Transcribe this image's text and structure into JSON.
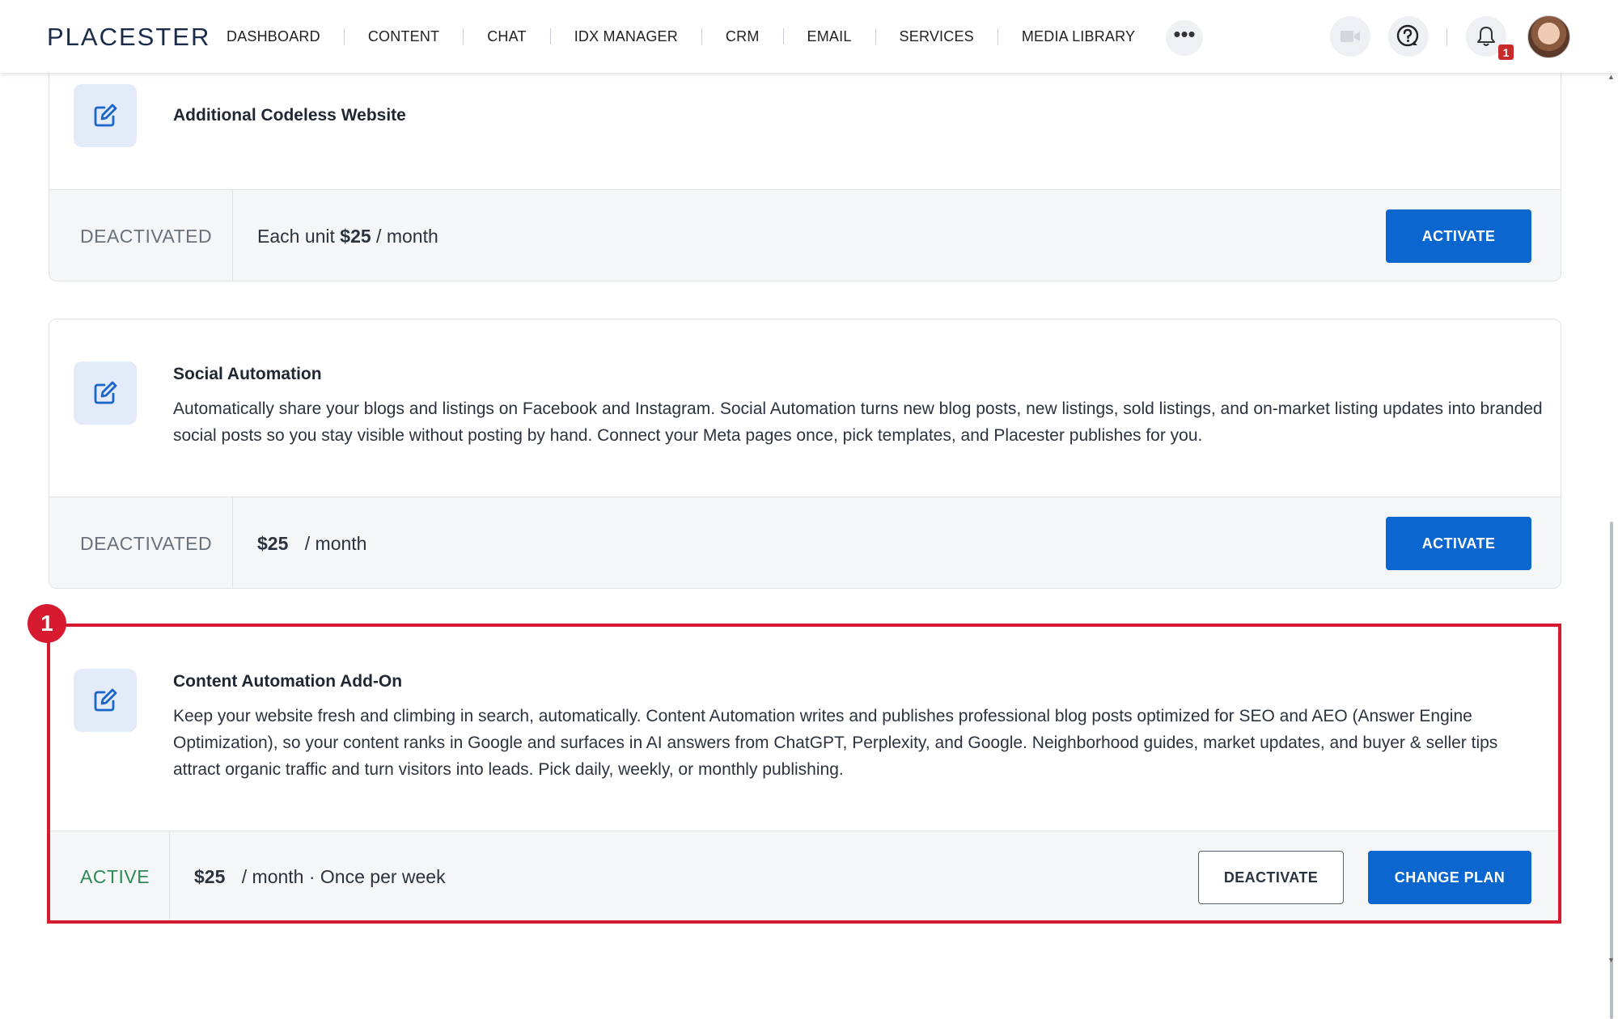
{
  "brand": {
    "logo": "PLACESTER",
    "primary_color": "#0b66d0",
    "highlight_color": "#d61a2f"
  },
  "nav": {
    "items": [
      "DASHBOARD",
      "CONTENT",
      "CHAT",
      "IDX MANAGER",
      "CRM",
      "EMAIL",
      "SERVICES",
      "MEDIA LIBRARY"
    ],
    "more": "•••",
    "notification_count": "1"
  },
  "cards": {
    "codeless": {
      "title": "Additional Codeless Website",
      "status": "DEACTIVATED",
      "price_prefix": "Each unit ",
      "price_amount": "$25",
      "price_suffix": " / month",
      "action": "ACTIVATE"
    },
    "social": {
      "title": "Social Automation",
      "description": "Automatically share your blogs and listings on Facebook and Instagram. Social Automation turns new blog posts, new listings, sold listings, and on-market listing updates into branded social posts so you stay visible without posting by hand. Connect your Meta pages once, pick templates, and Placester publishes for you.",
      "status": "DEACTIVATED",
      "price_amount": "$25",
      "price_suffix": "/ month",
      "action": "ACTIVATE"
    },
    "content": {
      "title": "Content Automation Add-On",
      "description": "Keep your website fresh and climbing in search, automatically. Content Automation writes and publishes professional blog posts optimized for SEO and AEO (Answer Engine Optimization), so your content ranks in Google and surfaces in AI answers from ChatGPT, Perplexity, and Google. Neighborhood guides, market updates, and buyer & seller tips attract organic traffic and turn visitors into leads. Pick daily, weekly, or monthly publishing.",
      "status": "ACTIVE",
      "price_amount": "$25",
      "price_suffix": "/ month · Once per week",
      "deactivate": "DEACTIVATE",
      "change_plan": "CHANGE PLAN"
    }
  },
  "annotation": {
    "marker": "1"
  }
}
